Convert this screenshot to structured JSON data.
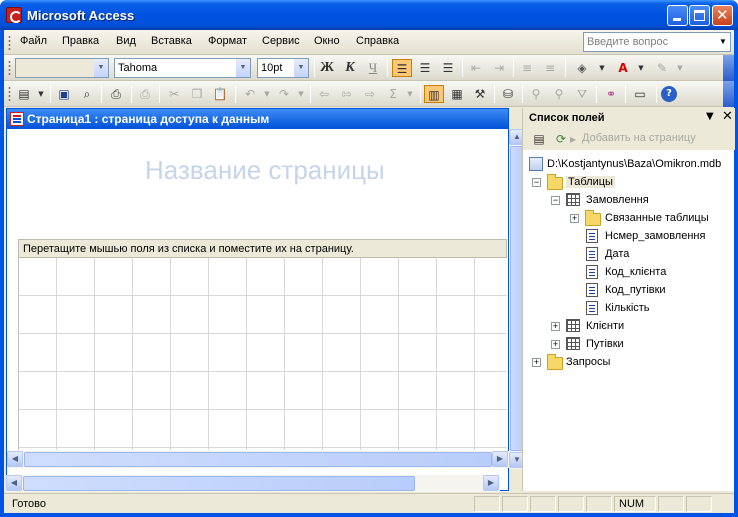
{
  "window": {
    "title": "Microsoft Access"
  },
  "menubar": {
    "items": [
      "Файл",
      "Правка",
      "Вид",
      "Вставка",
      "Формат",
      "Сервис",
      "Окно",
      "Справка"
    ],
    "ask_placeholder": "Введите вопрос"
  },
  "format_toolbar": {
    "object_combo": "",
    "font": "Tahoma",
    "size": "10pt",
    "bold_label": "Ж",
    "italic_label": "К",
    "underline_label": "Ч"
  },
  "document": {
    "title": "Страница1 : страница доступа к данным",
    "page_heading": "Название страницы",
    "section_hint": "Перетащите мышью поля из списка и поместите их на страницу."
  },
  "field_list": {
    "title": "Список полей",
    "add_to_page": "Добавить на страницу",
    "db_path": "D:\\Kostjantynus\\Baza\\Omikron.mdb",
    "tables_folder": "Таблицы",
    "table_orders": "Замовлення",
    "related_tables": "Связанные таблицы",
    "fields": [
      "Нсмер_замовлення",
      "Дата",
      "Код_клієнта",
      "Код_путівки",
      "Кількість"
    ],
    "table_clients": "Клієнти",
    "table_tours": "Путівки",
    "queries_folder": "Запросы"
  },
  "statusbar": {
    "text": "Готово",
    "num": "NUM"
  },
  "colors": {
    "titlebar": "#0053e0",
    "panel": "#ece9d8",
    "heading_placeholder": "#c6d4ea"
  }
}
